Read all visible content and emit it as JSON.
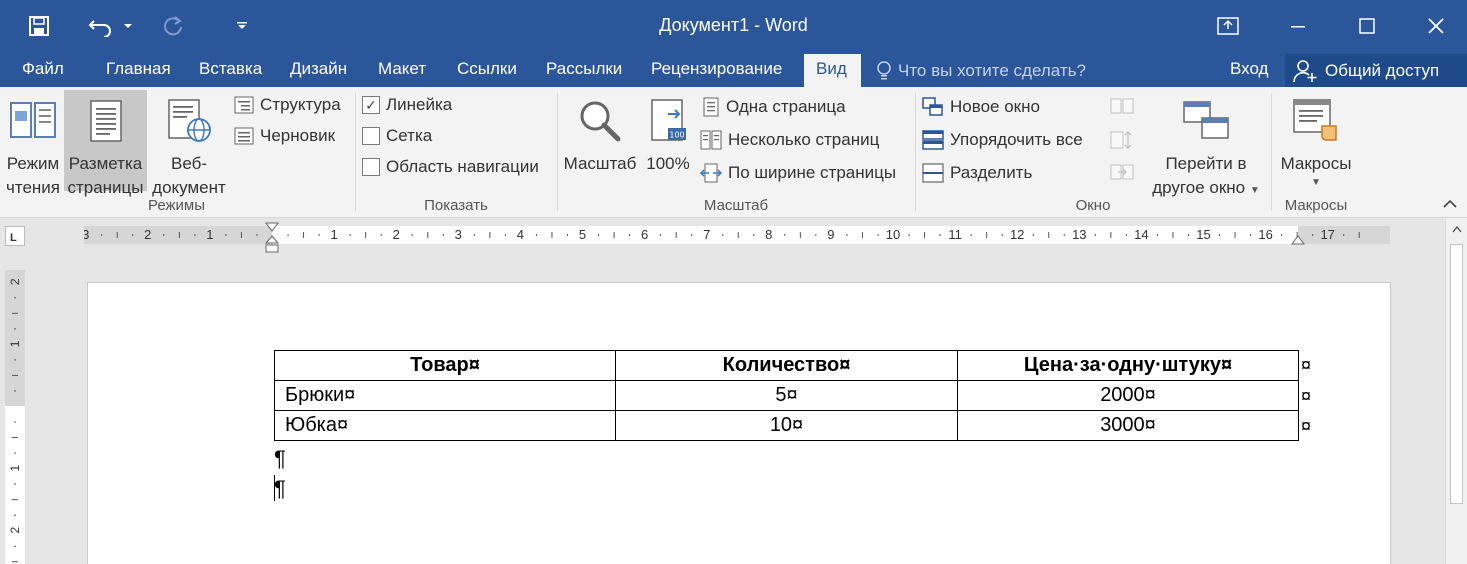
{
  "window": {
    "title": "Документ1 - Word"
  },
  "tabs": {
    "file": "Файл",
    "home": "Главная",
    "insert": "Вставка",
    "design": "Дизайн",
    "layout": "Макет",
    "references": "Ссылки",
    "mailings": "Рассылки",
    "review": "Рецензирование",
    "view": "Вид",
    "tell_me": "Что вы хотите сделать?",
    "sign_in": "Вход",
    "share": "Общий доступ"
  },
  "ribbon": {
    "views": {
      "read_mode_1": "Режим",
      "read_mode_2": "чтения",
      "print_layout_1": "Разметка",
      "print_layout_2": "страницы",
      "web_layout_1": "Веб-",
      "web_layout_2": "документ",
      "outline": "Структура",
      "draft": "Черновик",
      "group": "Режимы"
    },
    "show": {
      "ruler": "Линейка",
      "ruler_checked": true,
      "gridlines": "Сетка",
      "gridlines_checked": false,
      "nav_pane": "Область навигации",
      "nav_pane_checked": false,
      "group": "Показать"
    },
    "zoom": {
      "zoom": "Масштаб",
      "hundred": "100%",
      "one_page": "Одна страница",
      "multi_pages": "Несколько страниц",
      "page_width": "По ширине страницы",
      "group": "Масштаб"
    },
    "window": {
      "new_window": "Новое окно",
      "arrange_all": "Упорядочить все",
      "split": "Разделить",
      "switch_1": "Перейти в",
      "switch_2": "другое окно",
      "group": "Окно"
    },
    "macros": {
      "macros": "Макросы",
      "group": "Макросы"
    }
  },
  "ruler": {
    "h_labels": [
      "3",
      "2",
      "1",
      "1",
      "2",
      "3",
      "4",
      "5",
      "6",
      "7",
      "8",
      "9",
      "10",
      "11",
      "12",
      "13",
      "14",
      "15",
      "16",
      "17"
    ],
    "v_labels": [
      "2",
      "1",
      "1",
      "2"
    ]
  },
  "document": {
    "table": {
      "headers": [
        "Товар¤",
        "Количество¤",
        "Цена·за·одну·штуку¤"
      ],
      "rows": [
        [
          "Брюки¤",
          "5¤",
          "2000¤"
        ],
        [
          "Юбка¤",
          "10¤",
          "3000¤"
        ]
      ],
      "row_end_mark": "¤"
    },
    "paragraph_mark": "¶"
  },
  "colors": {
    "word_blue": "#2b579a",
    "ribbon_bg": "#f3f3f3",
    "canvas_bg": "#e6e6e6"
  }
}
